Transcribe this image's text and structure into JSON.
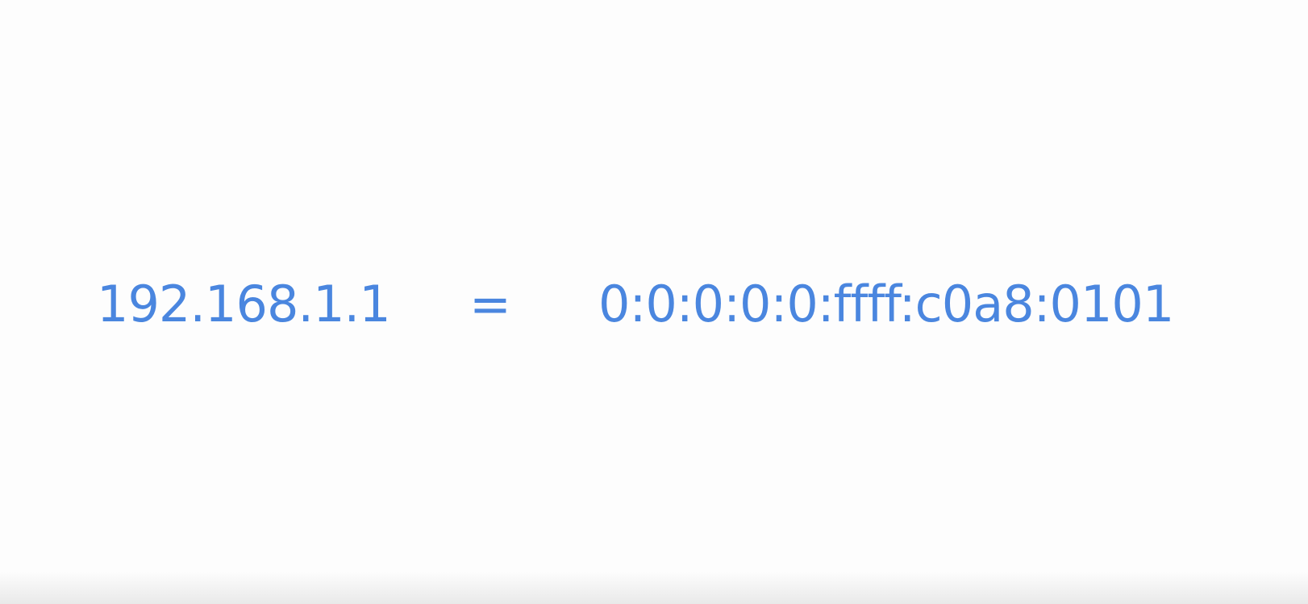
{
  "slide": {
    "ipv4_address": "192.168.1.1",
    "equals_sign": "=",
    "ipv6_address": "0:0:0:0:0:ffff:c0a8:0101"
  },
  "colors": {
    "text": "#4a86df",
    "background": "#fdfdfd"
  }
}
